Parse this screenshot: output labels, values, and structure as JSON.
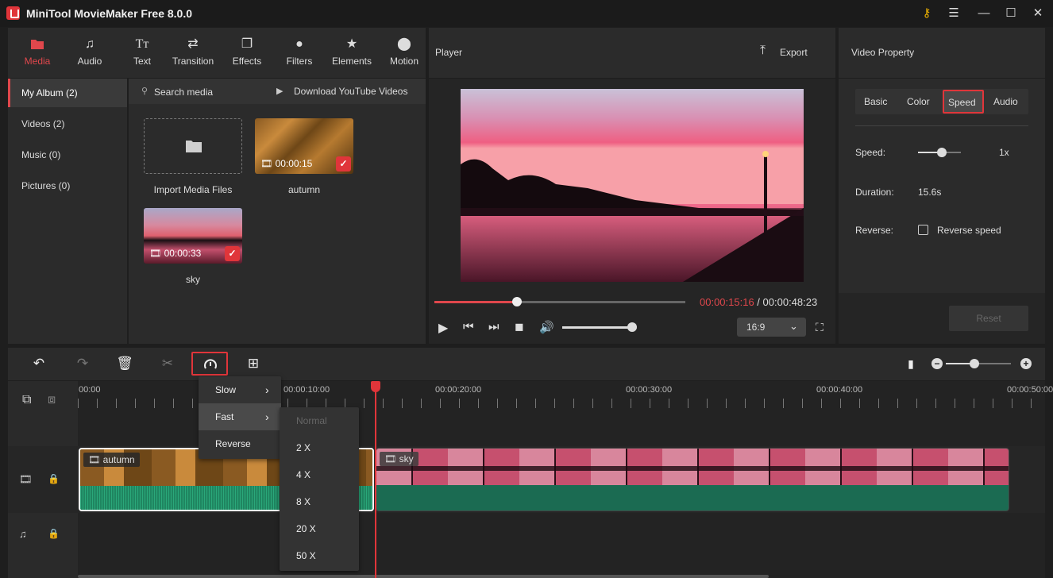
{
  "app": {
    "title": "MiniTool MovieMaker Free 8.0.0"
  },
  "toolbar": [
    {
      "label": "Media",
      "icon": "folder-icon"
    },
    {
      "label": "Audio",
      "icon": "music-note-icon"
    },
    {
      "label": "Text",
      "icon": "text-icon"
    },
    {
      "label": "Transition",
      "icon": "transition-arrows-icon"
    },
    {
      "label": "Effects",
      "icon": "effects-icon"
    },
    {
      "label": "Filters",
      "icon": "filters-icon"
    },
    {
      "label": "Elements",
      "icon": "elements-icon"
    },
    {
      "label": "Motion",
      "icon": "motion-icon"
    }
  ],
  "album": {
    "items": [
      "My Album (2)",
      "Videos (2)",
      "Music (0)",
      "Pictures (0)"
    ]
  },
  "media": {
    "search_label": "Search media",
    "download_label": "Download YouTube Videos",
    "import_label": "Import Media Files",
    "clips": [
      {
        "name": "autumn",
        "duration": "00:00:15"
      },
      {
        "name": "sky",
        "duration": "00:00:33"
      }
    ]
  },
  "player": {
    "title": "Player",
    "export_label": "Export",
    "current_time": "00:00:15:16",
    "separator": " / ",
    "total_time": "00:00:48:23",
    "aspect_ratio": "16:9",
    "progress": 0.33,
    "volume": 0.94
  },
  "property": {
    "title": "Video Property",
    "tabs": [
      "Basic",
      "Color",
      "Speed",
      "Audio"
    ],
    "speed_label": "Speed:",
    "speed_value": "1x",
    "duration_label": "Duration:",
    "duration_value": "15.6s",
    "reverse_label": "Reverse:",
    "reverse_checkbox": "Reverse speed",
    "reset_label": "Reset"
  },
  "timeline": {
    "ruler": [
      "00:00",
      "00:00:10:00",
      "00:00:20:00",
      "00:00:30:00",
      "00:00:40:00",
      "00:00:50:00"
    ],
    "clips": [
      {
        "name": "autumn"
      },
      {
        "name": "sky"
      }
    ]
  },
  "speed_menu": {
    "items": [
      "Slow",
      "Fast",
      "Reverse"
    ],
    "fast_submenu": [
      "Normal",
      "2 X",
      "4 X",
      "8 X",
      "20 X",
      "50 X"
    ]
  },
  "colors": {
    "accent": "#e0474c",
    "audio_wave": "#2aa87a"
  }
}
